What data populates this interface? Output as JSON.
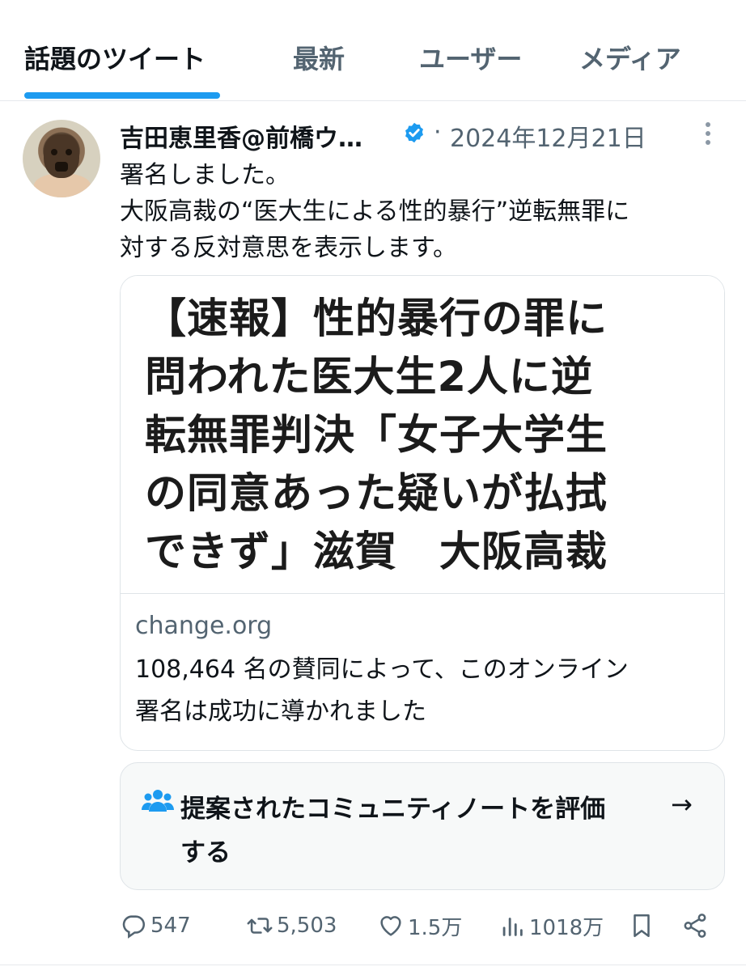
{
  "tabs": [
    {
      "label": "話題のツイート",
      "active": true
    },
    {
      "label": "最新",
      "active": false
    },
    {
      "label": "ユーザー",
      "active": false
    },
    {
      "label": "メディア",
      "active": false
    }
  ],
  "tweet": {
    "author_name": "吉田恵里香@前橋ウ…",
    "separator": "·",
    "date": "2024年12月21日",
    "text_lines": [
      "署名しました。",
      "大阪高裁の“医大生による性的暴行”逆転無罪に",
      "対する反対意思を表示します。"
    ],
    "card": {
      "headline_lines": [
        "【速報】性的暴行の罪に",
        "問われた医大生2人に逆",
        "転無罪判決「女子大学生",
        "の同意あった疑いが払拭",
        "できず」滋賀　大阪高裁"
      ],
      "domain": "change.org",
      "description_lines": [
        "108,464 名の賛同によって、このオンライン",
        "署名は成功に導かれました"
      ]
    },
    "community_note": {
      "lines": [
        "提案されたコミュニティノートを評価",
        "する"
      ],
      "arrow": "→",
      "icon": "people-group-icon"
    },
    "actions": {
      "replies": "547",
      "retweets": "5,503",
      "likes": "1.5万",
      "views": "1018万"
    }
  },
  "colors": {
    "accent": "#1d9bf0",
    "muted": "#536471",
    "text": "#0f1419"
  }
}
